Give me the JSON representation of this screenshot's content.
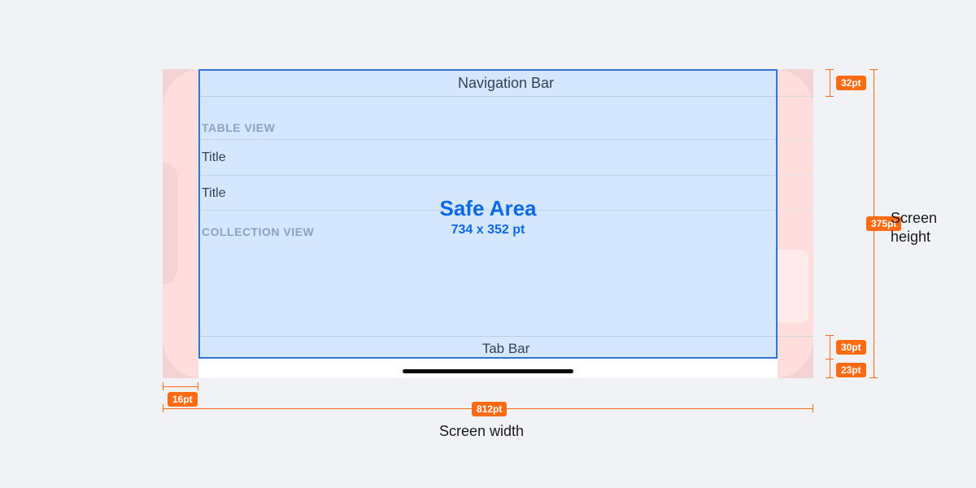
{
  "navbar": {
    "title": "Navigation Bar"
  },
  "table_view": {
    "header": "TABLE VIEW",
    "rows": [
      "Title",
      "Title"
    ]
  },
  "collection_view": {
    "header": "COLLECTION VIEW"
  },
  "tabbar": {
    "title": "Tab Bar"
  },
  "safe_area": {
    "title": "Safe Area",
    "dims": "734 x 352 pt"
  },
  "measurements": {
    "navbar_height": "32pt",
    "tabbar_height": "30pt",
    "home_indicator_height": "23pt",
    "side_margin": "16pt",
    "screen_width_value": "812pt",
    "screen_height_value": "375pt"
  },
  "axis_labels": {
    "width": "Screen width",
    "height": "Screen height"
  }
}
